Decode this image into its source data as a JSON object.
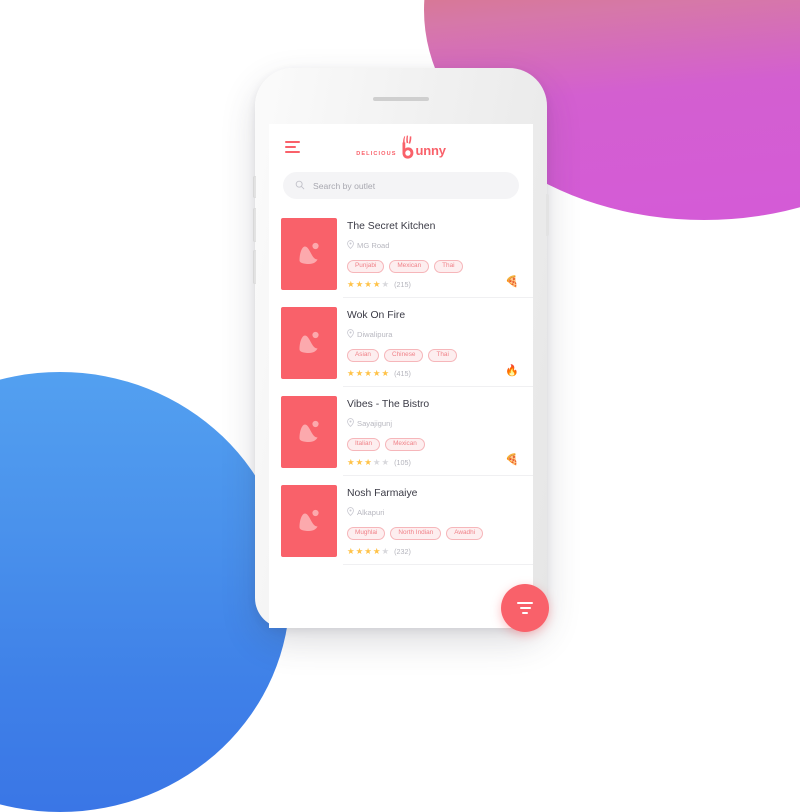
{
  "background": {
    "warm_blob_colors": [
      "#e8833c",
      "#d45ad8"
    ],
    "cool_blob_colors": [
      "#53a0f0",
      "#3a76e6"
    ],
    "page_color": "#ffffff"
  },
  "theme": {
    "accent": "#f9616a",
    "star_on": "#ffc247",
    "star_off": "#d8d8dc",
    "tag_text": "#f08289",
    "tag_bg": "#fdeeef",
    "tag_border": "#f6b6ba"
  },
  "device": {
    "body_label": "white-iphone-mockup",
    "speaker_label": "earpiece-speaker",
    "volume_buttons": [
      "silent-switch",
      "volume-up",
      "volume-down"
    ],
    "power_button": "power-button"
  },
  "header": {
    "menu_icon": "hamburger-icon",
    "logo": {
      "prefix": "DELICIOUS",
      "word": "unny",
      "mark": "bunny-b-mark"
    }
  },
  "search": {
    "icon": "search-icon",
    "placeholder": "Search by outlet",
    "value": ""
  },
  "restaurants": [
    {
      "name": "The Secret Kitchen",
      "location": "MG Road",
      "location_icon": "map-pin-icon",
      "thumbnail_icon": "image-placeholder-icon",
      "tags": [
        "Punjabi",
        "Mexican",
        "Thai"
      ],
      "rating": 4,
      "max_rating": 5,
      "review_count": "(215)",
      "badge": "🍕",
      "badge_name": "pizza-badge-icon"
    },
    {
      "name": "Wok On Fire",
      "location": "Diwalipura",
      "location_icon": "map-pin-icon",
      "thumbnail_icon": "image-placeholder-icon",
      "tags": [
        "Asian",
        "Chinese",
        "Thai"
      ],
      "rating": 5,
      "max_rating": 5,
      "review_count": "(415)",
      "badge": "🔥",
      "badge_name": "flame-badge-icon"
    },
    {
      "name": "Vibes - The Bistro",
      "location": "Sayajigunj",
      "location_icon": "map-pin-icon",
      "thumbnail_icon": "image-placeholder-icon",
      "tags": [
        "Italian",
        "Mexican"
      ],
      "rating": 3,
      "max_rating": 5,
      "review_count": "(105)",
      "badge": "🍕",
      "badge_name": "pizza-badge-icon"
    },
    {
      "name": "Nosh Farmaiye",
      "location": "Alkapuri",
      "location_icon": "map-pin-icon",
      "thumbnail_icon": "image-placeholder-icon",
      "tags": [
        "Mughlai",
        "North Indian",
        "Awadhi"
      ],
      "rating": 4,
      "max_rating": 5,
      "review_count": "(232)",
      "badge": "",
      "badge_name": "none"
    }
  ],
  "fab": {
    "icon": "filter-funnel-icon",
    "label": "Filter"
  }
}
